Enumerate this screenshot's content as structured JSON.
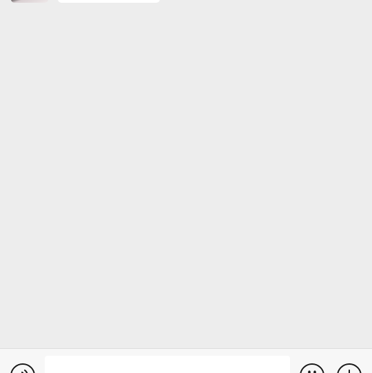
{
  "chat": {
    "messages": [
      {
        "sender": "contact",
        "text": ""
      }
    ]
  },
  "input_bar": {
    "voice_icon": "voice-icon",
    "text_value": "",
    "text_placeholder": "",
    "emoji_icon": "emoji-icon",
    "plus_icon": "plus-icon"
  }
}
